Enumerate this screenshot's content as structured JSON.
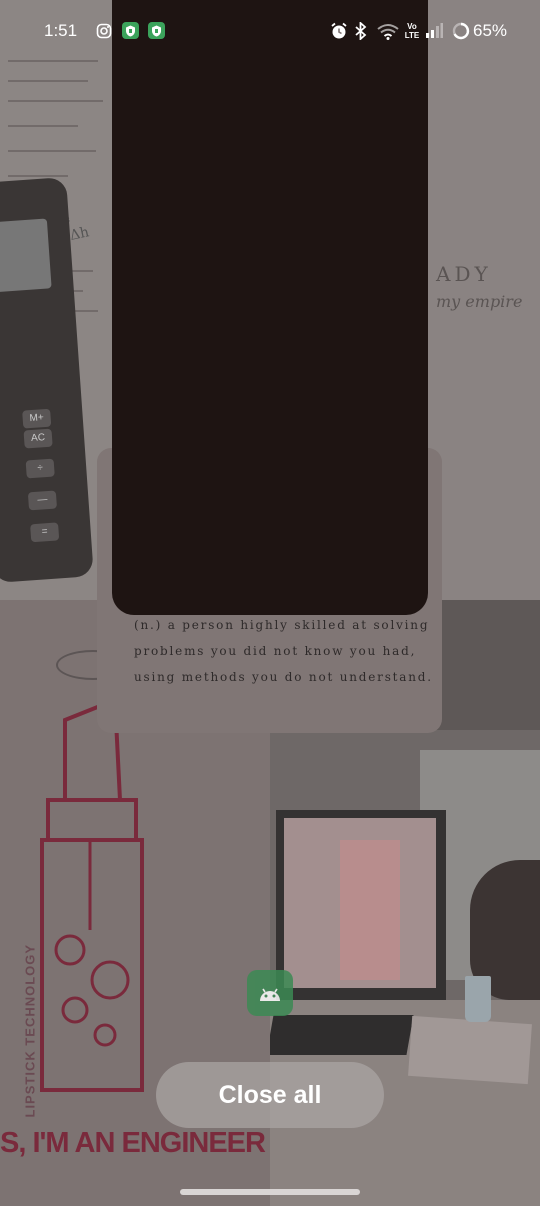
{
  "status_bar": {
    "time": "1:51",
    "battery_percent": "65%",
    "volte_label": "Vo LTE",
    "icons": [
      "instagram-icon",
      "shield-icon",
      "shield-icon",
      "alarm-icon",
      "bluetooth-icon",
      "wifi-icon",
      "volte-icon",
      "signal-icon",
      "battery-icon"
    ]
  },
  "wallpaper": {
    "formula": "E = mgΔh",
    "lady_title": "ADY",
    "lady_script": "my empire",
    "lipstick_vertical": "LIPSTICK TECHNOLOGY",
    "engineer_banner": "S, I'M AN ENGINEER",
    "calc_keys": [
      "AC",
      "÷",
      "M+",
      "—",
      "="
    ]
  },
  "recent_card": {
    "engineer_definition": "(n.) a person highly skilled at solving problems you did not know you had, using methods you do not understand."
  },
  "controls": {
    "close_all_label": "Close all"
  },
  "colors": {
    "app_card_bg": "#1e1412",
    "app_icon_bg": "#3c8a54",
    "shield_green": "#3ba35b"
  }
}
